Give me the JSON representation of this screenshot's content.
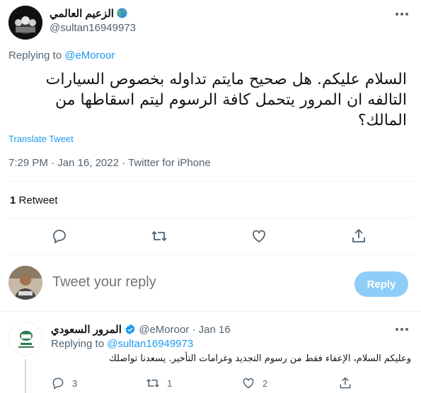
{
  "tweet": {
    "author_name": "الزعيم العالمي",
    "author_handle": "@sultan16949973",
    "replying_label": "Replying to",
    "replying_handle": "@eMoroor",
    "text": "السلام عليكم. هل صحيح مايتم تداوله بخصوص السيارات التالفه ان المرور يتحمل كافة الرسوم ليتم اسقاطها من المالك؟",
    "translate": "Translate Tweet",
    "timestamp": "7:29 PM · Jan 16, 2022 · Twitter for iPhone",
    "retweet_count": "1",
    "retweet_label": "Retweet"
  },
  "icons": {
    "reply": "reply-icon",
    "retweet": "retweet-icon",
    "like": "heart-icon",
    "share": "share-icon",
    "more": "more-icon",
    "verified": "verified-badge-icon",
    "globe": "globe-emoji-icon"
  },
  "composer": {
    "placeholder": "Tweet your reply",
    "button": "Reply"
  },
  "reply": {
    "author_name": "المرور السعودي",
    "author_handle": "@eMoroor",
    "date": "· Jan 16",
    "replying_label": "Replying to",
    "replying_handle": "@sultan16949973",
    "text": "وعليكم السلام، الإعفاء فقط من رسوم التجديد وغرامات التأخير. يسعدنا تواصلك",
    "reply_count": "3",
    "retweet_count": "1",
    "like_count": "2"
  },
  "colors": {
    "accent": "#1d9bf0",
    "reply_button_disabled": "#8ecdf8",
    "secondary_text": "#536471"
  }
}
